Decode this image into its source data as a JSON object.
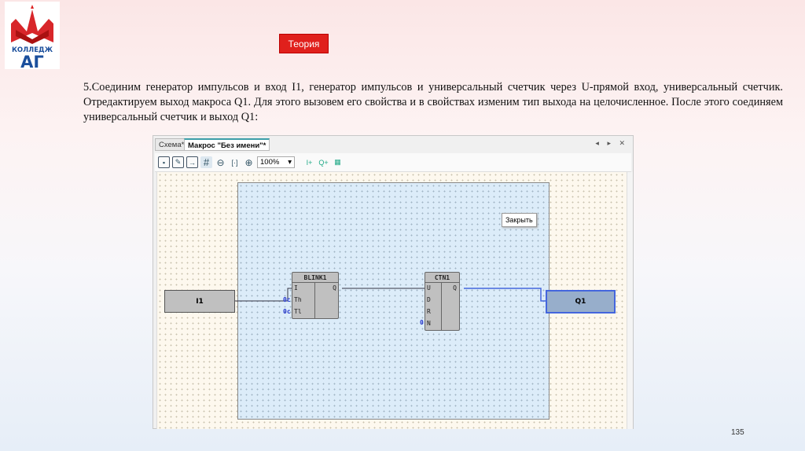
{
  "logo": {
    "text": "КОЛЛЕДЖ",
    "letters": "АГ"
  },
  "theory_button": "Теория",
  "paragraph": "5.Соединим генератор импульсов и вход I1, генератор импульсов и универсальный счетчик через U-прямой вход, универсальный счетчик. Отредактируем выход макроса Q1. Для этого вызовем его свойства и в свойствах изменим тип выхода на целочисленное. После этого соединяем универсальный счетчик и выход Q1:",
  "window": {
    "tabs": [
      {
        "label": "Схема*"
      },
      {
        "label": "Макрос \"Без имени\"*"
      }
    ],
    "tab_nav": "◂ ▸ ✕",
    "zoom": "100%",
    "tooltip": "Закрыть",
    "input_block": "I1",
    "output_block": "Q1",
    "blink": {
      "title": "BLINK1",
      "inputs": [
        "I",
        "Th",
        "Tl"
      ],
      "output": "Q",
      "consts": [
        "0c",
        "0c"
      ]
    },
    "ctn": {
      "title": "CTN1",
      "inputs": [
        "U",
        "D",
        "R",
        "N"
      ],
      "output": "Q",
      "const": "0"
    }
  },
  "page_number": "135",
  "colors": {
    "accent": "#e0201c",
    "macro_bg": "#dcecf9",
    "output_fill": "#97aecb",
    "wire_blue": "#4466dd"
  }
}
